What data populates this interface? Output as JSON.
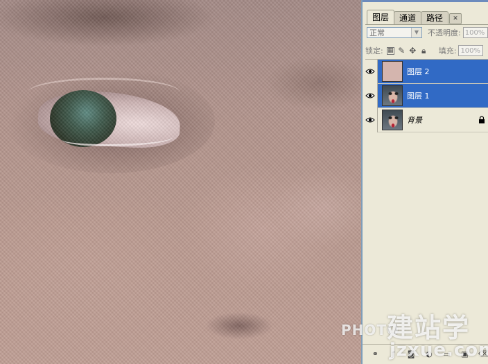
{
  "layers_panel": {
    "tabs": [
      {
        "label": "图层"
      },
      {
        "label": "通道"
      },
      {
        "label": "路径"
      }
    ],
    "blend_mode": "正常",
    "opacity_label": "不透明度:",
    "opacity_value": "100%",
    "lock_label": "锁定:",
    "fill_label": "填充:",
    "fill_value": "100%",
    "layers": [
      {
        "name": "图层 2",
        "selected": true,
        "thumbnail": "pink-fill"
      },
      {
        "name": "图层 1",
        "selected": true,
        "thumbnail": "portrait-photo"
      },
      {
        "name": "背景",
        "selected": false,
        "thumbnail": "portrait-photo",
        "locked": true
      }
    ],
    "bottom_icons": [
      "link-icon",
      "layer-style-icon",
      "mask-icon",
      "adjustment-icon",
      "folder-icon",
      "new-layer-icon",
      "trash-icon"
    ]
  },
  "watermark": {
    "brand": "PHOTO",
    "cn": "建站学",
    "url": "jzxue.com"
  }
}
